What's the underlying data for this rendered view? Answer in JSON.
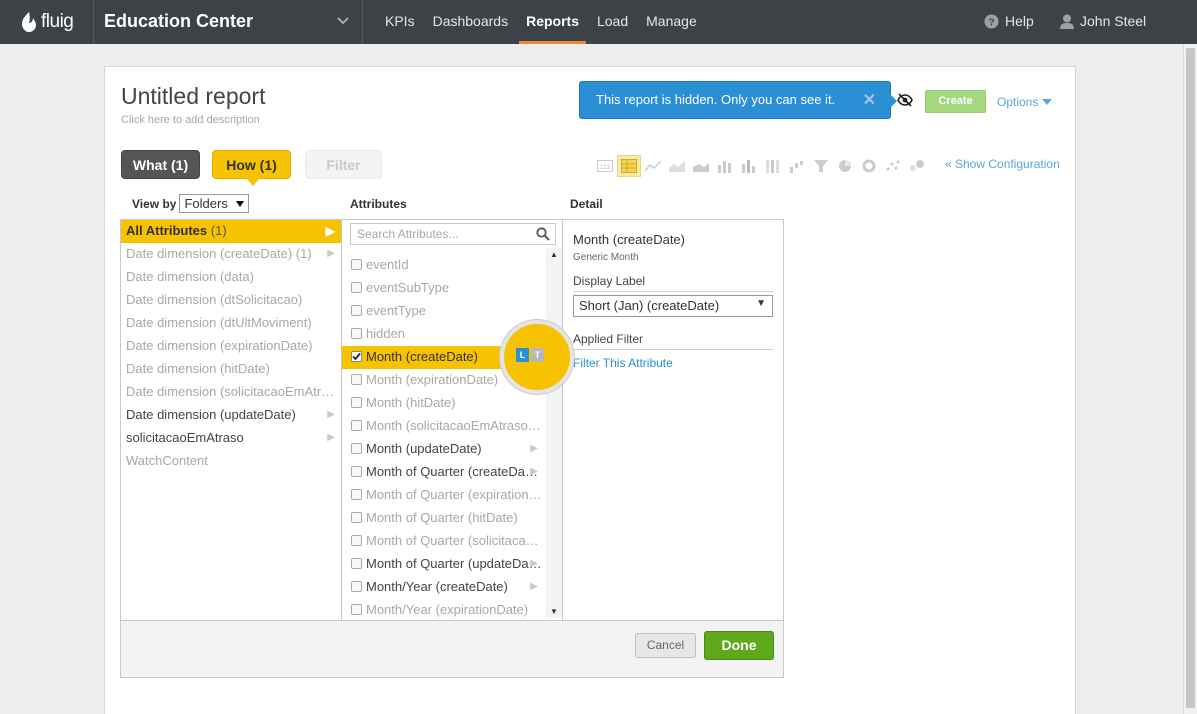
{
  "topbar": {
    "logo_text": "fluig",
    "brand": "Education Center",
    "nav": [
      "KPIs",
      "Dashboards",
      "Reports",
      "Load",
      "Manage"
    ],
    "active_nav": "Reports",
    "help": "Help",
    "user": "John Steel"
  },
  "report": {
    "title": "Untitled report",
    "description_placeholder": "Click here to add description",
    "hidden_notice": "This report is hidden. Only you can see it.",
    "close_symbol": "✕",
    "create_label": "Create",
    "options_label": "Options"
  },
  "tabs": {
    "what": "What (1)",
    "how": "How (1)",
    "filter": "Filter"
  },
  "chart_types": [
    "table-123",
    "table-grid",
    "line",
    "area-line",
    "area",
    "bar",
    "bar-stacked",
    "bar-100",
    "waterfall",
    "funnel",
    "pie",
    "donut",
    "scatter",
    "bubble"
  ],
  "show_config": "« Show Configuration",
  "view_by": {
    "label": "View by",
    "value": "Folders"
  },
  "columns": {
    "attributes": "Attributes",
    "detail": "Detail"
  },
  "folders": [
    {
      "label": "All Attributes",
      "count": "(1)",
      "state": "sel",
      "arrow": true
    },
    {
      "label": "Date dimension (createDate) (1)",
      "count": "",
      "state": "dim",
      "arrow": true
    },
    {
      "label": "Date dimension (data)",
      "count": "",
      "state": "dim",
      "arrow": false
    },
    {
      "label": "Date dimension (dtSolicitacao)",
      "count": "",
      "state": "dim",
      "arrow": false
    },
    {
      "label": "Date dimension (dtUltMoviment)",
      "count": "",
      "state": "dim",
      "arrow": false
    },
    {
      "label": "Date dimension (expirationDate)",
      "count": "",
      "state": "dim",
      "arrow": false
    },
    {
      "label": "Date dimension (hitDate)",
      "count": "",
      "state": "dim",
      "arrow": false
    },
    {
      "label": "Date dimension (solicitacaoEmAtr…",
      "count": "",
      "state": "dim",
      "arrow": false
    },
    {
      "label": "Date dimension (updateDate)",
      "count": "",
      "state": "norm",
      "arrow": true
    },
    {
      "label": "solicitacaoEmAtraso",
      "count": "",
      "state": "norm",
      "arrow": true
    },
    {
      "label": "WatchContent",
      "count": "",
      "state": "dim",
      "arrow": false
    }
  ],
  "search_placeholder": "Search Attributes...",
  "attributes": [
    {
      "label": "eventId",
      "state": "dim",
      "checked": false,
      "arrow": false
    },
    {
      "label": "eventSubType",
      "state": "dim",
      "checked": false,
      "arrow": false
    },
    {
      "label": "eventType",
      "state": "dim",
      "checked": false,
      "arrow": false
    },
    {
      "label": "hidden",
      "state": "dim",
      "checked": false,
      "arrow": false
    },
    {
      "label": "Month (createDate)",
      "state": "sel",
      "checked": true,
      "arrow": false
    },
    {
      "label": "Month (expirationDate)",
      "state": "dim",
      "checked": false,
      "arrow": false
    },
    {
      "label": "Month (hitDate)",
      "state": "dim",
      "checked": false,
      "arrow": false
    },
    {
      "label": "Month (solicitacaoEmAtraso…",
      "state": "dim",
      "checked": false,
      "arrow": false
    },
    {
      "label": "Month (updateDate)",
      "state": "norm",
      "checked": false,
      "arrow": true
    },
    {
      "label": "Month of Quarter (createDa…",
      "state": "norm",
      "checked": false,
      "arrow": true
    },
    {
      "label": "Month of Quarter (expiration…",
      "state": "dim",
      "checked": false,
      "arrow": false
    },
    {
      "label": "Month of Quarter (hitDate)",
      "state": "dim",
      "checked": false,
      "arrow": false
    },
    {
      "label": "Month of Quarter (solicitaca…",
      "state": "dim",
      "checked": false,
      "arrow": false
    },
    {
      "label": "Month of Quarter (updateDa…",
      "state": "norm",
      "checked": false,
      "arrow": true
    },
    {
      "label": "Month/Year (createDate)",
      "state": "norm",
      "checked": false,
      "arrow": true
    },
    {
      "label": "Month/Year (expirationDate)",
      "state": "dim",
      "checked": false,
      "arrow": false
    }
  ],
  "magnifier": {
    "left_letter": "L",
    "right_letter": "T"
  },
  "detail": {
    "name": "Month (createDate)",
    "sub": "Generic Month",
    "display_label": "Display Label",
    "display_value": "Short (Jan) (createDate)",
    "applied_filter": "Applied Filter",
    "filter_link": "Filter This Attribute"
  },
  "footer": {
    "cancel": "Cancel",
    "done": "Done"
  },
  "colors": {
    "accent": "#f7c200",
    "nav_bg": "#3d4247",
    "active_nav": "#f0873a",
    "tooltip": "#2b8fd6",
    "done": "#5fa81c"
  }
}
